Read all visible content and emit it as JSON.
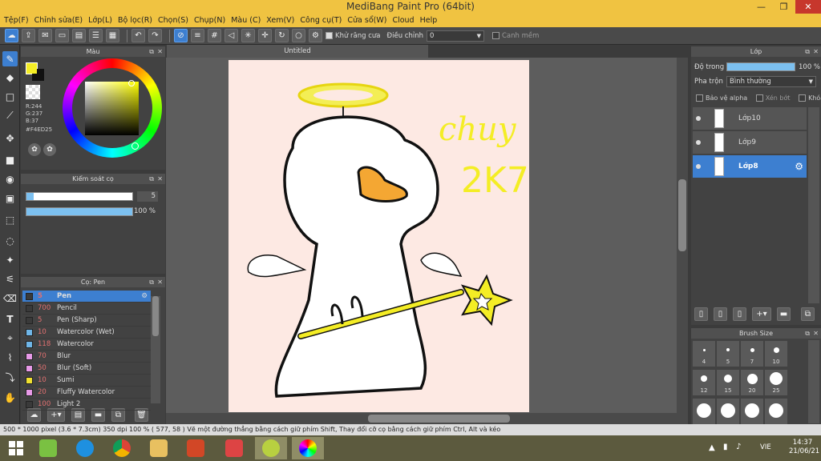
{
  "window": {
    "title": "MediBang Paint Pro (64bit)"
  },
  "menu": [
    "Tệp(F)",
    "Chỉnh sửa(E)",
    "Lớp(L)",
    "Bộ lọc(R)",
    "Chọn(S)",
    "Chụp(N)",
    "Màu (C)",
    "Xem(V)",
    "Công cụ(T)",
    "Cửa sổ(W)",
    "Cloud",
    "Help"
  ],
  "toolbar": {
    "antialias_label": "Khử răng cưa",
    "adjust_label": "Điều chỉnh",
    "adjust_value": "0",
    "snap_label": "Canh mềm"
  },
  "color_panel": {
    "title": "Màu",
    "r": "R:244",
    "g": "G:237",
    "b": "B:37",
    "hex": "#F4ED25",
    "primary_color": "#F4ED25"
  },
  "brush_control": {
    "title": "Kiểm soát cọ",
    "size_value": "5",
    "opacity_value": "100 %",
    "opacity_level": 1.0
  },
  "brush_list": {
    "title": "Cọ: Pen",
    "items": [
      {
        "size": "5",
        "name": "Pen",
        "color": "#3a3a3a"
      },
      {
        "size": "700",
        "name": "Pencil",
        "color": "#3a3a3a"
      },
      {
        "size": "5",
        "name": "Pen (Sharp)",
        "color": "#3a3a3a"
      },
      {
        "size": "10",
        "name": "Watercolor (Wet)",
        "color": "#6fb6e8"
      },
      {
        "size": "118",
        "name": "Watercolor",
        "color": "#6fb6e8"
      },
      {
        "size": "70",
        "name": "Blur",
        "color": "#e89ae8"
      },
      {
        "size": "50",
        "name": "Blur (Soft)",
        "color": "#e89ae8"
      },
      {
        "size": "10",
        "name": "Sumi",
        "color": "#f0e030"
      },
      {
        "size": "20",
        "name": "Fluffy Watercolor",
        "color": "#e89ae8"
      },
      {
        "size": "100",
        "name": "Light 2",
        "color": "#3a3a3a"
      }
    ]
  },
  "canvas": {
    "tab_title": "Untitled",
    "handwriting": [
      "chuy",
      "2K7"
    ]
  },
  "layer_panel": {
    "title": "Lớp",
    "opacity_label": "Độ trong",
    "opacity_value": "100 %",
    "opacity_level": 1.0,
    "blend_label": "Pha trộn",
    "blend_value": "Bình thường",
    "protect_alpha": "Bảo vệ alpha",
    "clipping": "Xén bớt",
    "lock": "Khóa",
    "layers": [
      {
        "name": "Lớp10",
        "selected": false
      },
      {
        "name": "Lớp9",
        "selected": false
      },
      {
        "name": "Lớp8",
        "selected": true
      }
    ]
  },
  "brush_size_panel": {
    "title": "Brush Size",
    "sizes": [
      "4",
      "5",
      "7",
      "10",
      "12",
      "15",
      "20",
      "25",
      "",
      "",
      "",
      ""
    ]
  },
  "status": {
    "text": "500 * 1000 pixel   (3.6 * 7.3cm)   350 dpi   100 %   ( 577, 58 )   Vẽ một đường thẳng bằng cách giữ phím Shift, Thay đổi cỡ cọ bằng cách giữ phím Ctrl, Alt và kéo"
  },
  "taskbar": {
    "lang": "VIE",
    "time": "14:37",
    "date": "21/06/21"
  }
}
